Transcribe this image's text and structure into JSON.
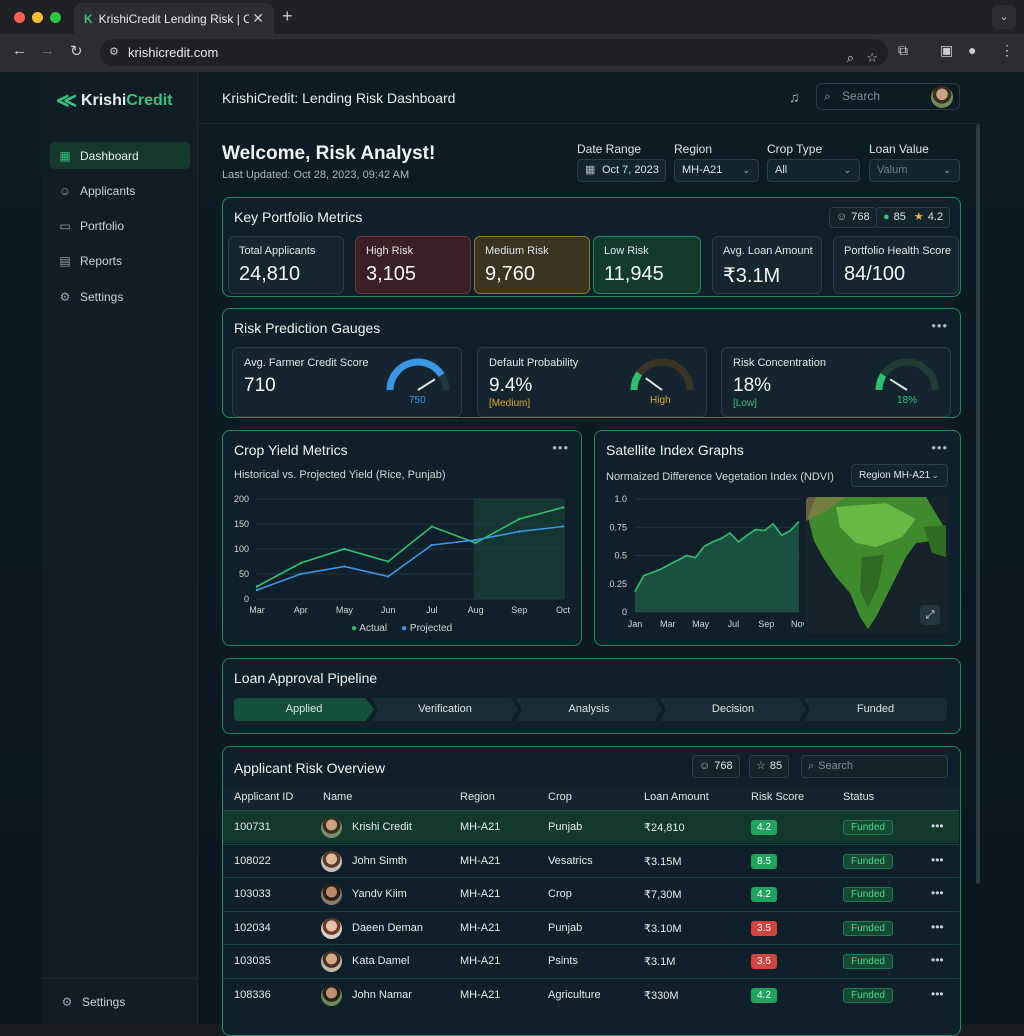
{
  "browser": {
    "tab_title": "KrishiCredit Lending Risk | Oct",
    "url": "krishicredit.com"
  },
  "brand": {
    "name_a": "Krishi",
    "name_b": "Credit",
    "accent": "#36c27f"
  },
  "sidebar": {
    "items": [
      {
        "label": "Dashboard",
        "icon": "grid-icon"
      },
      {
        "label": "Applicants",
        "icon": "users-icon"
      },
      {
        "label": "Portfolio",
        "icon": "folder-icon"
      },
      {
        "label": "Reports",
        "icon": "document-icon"
      },
      {
        "label": "Settings",
        "icon": "gear-icon"
      }
    ],
    "footer_label": "Settings"
  },
  "header": {
    "title": "KrishiCredit: Lending Risk Dashboard",
    "search_placeholder": "Search"
  },
  "welcome": {
    "title": "Welcome, Risk Analyst!",
    "updated": "Last Updated: Oct 28, 2023, 09:42 AM"
  },
  "filters": {
    "date_range": {
      "label": "Date Range",
      "value": "Oct 7, 2023"
    },
    "region": {
      "label": "Region",
      "value": "MH-A21"
    },
    "crop_type": {
      "label": "Crop Type",
      "value": "All"
    },
    "loan_value": {
      "label": "Loan Value",
      "placeholder": "Valum"
    }
  },
  "metrics": {
    "title": "Key Portfolio Metrics",
    "pills": {
      "users": "768",
      "score": "85",
      "rating": "4.2"
    },
    "cards": [
      {
        "label": "Total Applicants",
        "value": "24,810"
      },
      {
        "label": "High Risk",
        "value": "3,105"
      },
      {
        "label": "Medium Risk",
        "value": "9,760"
      },
      {
        "label": "Low Risk",
        "value": "11,945"
      },
      {
        "label": "Avg. Loan Amount",
        "value": "₹3.1M"
      },
      {
        "label": "Portfolio Health Score",
        "value": "84/100"
      }
    ]
  },
  "gauges": {
    "title": "Risk Prediction Gauges",
    "items": [
      {
        "label": "Avg. Farmer Credit Score",
        "value": "710",
        "status": "",
        "gauge_text": "750",
        "level": 0.82
      },
      {
        "label": "Default Probability",
        "value": "9.4%",
        "status": "[Medium]",
        "gauge_text": "High",
        "level": 0.2
      },
      {
        "label": "Risk Concentration",
        "value": "18%",
        "status": "[Low]",
        "gauge_text": "18%",
        "level": 0.18
      }
    ]
  },
  "crop": {
    "title": "Crop Yield Metrics",
    "subtitle": "Historical vs. Projected Yield (Rice, Punjab)",
    "legend": {
      "actual": "Actual",
      "projected": "Projected"
    }
  },
  "satellite": {
    "title": "Satellite Index Graphs",
    "subtitle": "Normaized Difference Vegetation Index (NDVI)",
    "region_select": "Region MH-A21"
  },
  "pipeline": {
    "title": "Loan Approval Pipeline",
    "stages": [
      "Applied",
      "Verification",
      "Analysis",
      "Decision",
      "Funded"
    ]
  },
  "applicants": {
    "title": "Applicant Risk Overview",
    "pills": {
      "users": "768",
      "stars": "85"
    },
    "search_placeholder": "Search",
    "columns": [
      "Applicant ID",
      "Name",
      "Region",
      "Crop",
      "Loan Amount",
      "Risk Score",
      "Status"
    ],
    "rows": [
      {
        "id": "100731",
        "name": "Krishi Credit",
        "region": "MH-A21",
        "crop": "Punjab",
        "loan": "₹24,810",
        "risk": "4.2",
        "risk_color": "#1fa35f",
        "status": "Funded"
      },
      {
        "id": "108022",
        "name": "John Simth",
        "region": "MH-A21",
        "crop": "Vesatrics",
        "loan": "₹3.15M",
        "risk": "8.5",
        "risk_color": "#1fa35f",
        "status": "Funded"
      },
      {
        "id": "103033",
        "name": "Yandv Kiim",
        "region": "MH-A21",
        "crop": "Crop",
        "loan": "₹7,30M",
        "risk": "4.2",
        "risk_color": "#1fa35f",
        "status": "Funded"
      },
      {
        "id": "102034",
        "name": "Daeen Deman",
        "region": "MH-A21",
        "crop": "Punjab",
        "loan": "₹3.10M",
        "risk": "3.5",
        "risk_color": "#d0453f",
        "status": "Funded"
      },
      {
        "id": "103035",
        "name": "Kata Damel",
        "region": "MH-A21",
        "crop": "Psints",
        "loan": "₹3.1M",
        "risk": "3.5",
        "risk_color": "#d0453f",
        "status": "Funded"
      },
      {
        "id": "108336",
        "name": "John Namar",
        "region": "MH-A21",
        "crop": "Agriculture",
        "loan": "₹330M",
        "risk": "4.2",
        "risk_color": "#1fa35f",
        "status": "Funded"
      }
    ]
  },
  "chart_data": [
    {
      "type": "line",
      "title": "Historical vs. Projected Yield (Rice, Punjab)",
      "categories": [
        "Mar",
        "Apr",
        "May",
        "Jun",
        "Jul",
        "Aug",
        "Sep",
        "Oct"
      ],
      "ylim": [
        0,
        200
      ],
      "yticks": [
        0,
        50,
        100,
        150,
        200
      ],
      "grid": true,
      "legend_position": "bottom",
      "series": [
        {
          "name": "Actual",
          "color": "#2fbf71",
          "values": [
            25,
            72,
            100,
            75,
            145,
            112,
            160,
            183
          ]
        },
        {
          "name": "Projected",
          "color": "#3a97e6",
          "values": [
            18,
            50,
            65,
            45,
            108,
            118,
            135,
            145
          ]
        }
      ]
    },
    {
      "type": "area",
      "title": "Normaized Difference Vegetation Index (NDVI)",
      "categories": [
        "Jan",
        "Mar",
        "May",
        "Jul",
        "Sep",
        "Nov"
      ],
      "ylim": [
        0,
        1.0
      ],
      "yticks": [
        0,
        0.25,
        0.5,
        0.75,
        1.0
      ],
      "grid": true,
      "series": [
        {
          "name": "",
          "color": "#2fbf71",
          "values": [
            0.18,
            0.32,
            0.35,
            0.38,
            0.42,
            0.46,
            0.5,
            0.48,
            0.58,
            0.62,
            0.65,
            0.7,
            0.62,
            0.68,
            0.73,
            0.72,
            0.78,
            0.68,
            0.72,
            0.8
          ]
        }
      ]
    }
  ]
}
